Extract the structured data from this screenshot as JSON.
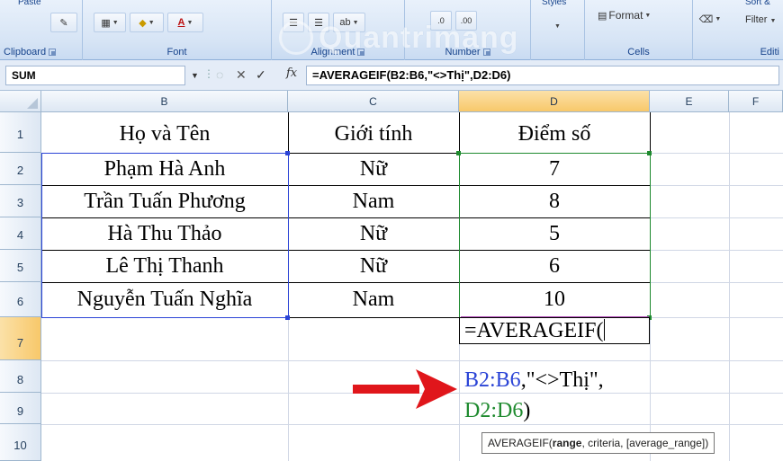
{
  "ribbon": {
    "groups": {
      "clipboard": {
        "label": "Clipboard",
        "cutoff": "Paste"
      },
      "font": {
        "label": "Font"
      },
      "alignment": {
        "label": "Alignment"
      },
      "number": {
        "label": "Number"
      },
      "styles": {
        "cutoff": "Styles"
      },
      "cells": {
        "label": "Cells",
        "format_label": "Format"
      },
      "editing": {
        "label": "Editi",
        "filter_label": "Filter",
        "sort_cutoff": "Sort &"
      }
    },
    "watermark": "Quantrimang"
  },
  "formula_bar": {
    "name_box": "SUM",
    "fx_label": "fx",
    "formula": "=AVERAGEIF(B2:B6,\"<>Thị\",D2:D6)"
  },
  "columns": [
    "B",
    "C",
    "D",
    "E",
    "F"
  ],
  "rows": [
    "1",
    "2",
    "3",
    "4",
    "5",
    "6",
    "7",
    "8",
    "9",
    "10"
  ],
  "active_column": "D",
  "active_row": "7",
  "table": {
    "headers": [
      "Họ và Tên",
      "Giới tính",
      "Điểm số"
    ],
    "data": [
      [
        "Phạm Hà Anh",
        "Nữ",
        "7"
      ],
      [
        "Trần Tuấn Phương",
        "Nam",
        "8"
      ],
      [
        "Hà Thu Thảo",
        "Nữ",
        "5"
      ],
      [
        "Lê Thị Thanh",
        "Nữ",
        "6"
      ],
      [
        "Nguyễn Tuấn Nghĩa",
        "Nam",
        "10"
      ]
    ]
  },
  "editing_cell": {
    "line1": "=AVERAGEIF(",
    "range_ref": "B2:B6",
    "criteria": ",\"<>Thị\",",
    "avg_ref": "D2:D6",
    "close": ")"
  },
  "tooltip": {
    "func": "AVERAGEIF(",
    "arg_bold": "range",
    "rest": ", criteria, [average_range])"
  },
  "colors": {
    "range_blue": "#2b44d6",
    "range_green": "#1e8a2e",
    "arrow_red": "#e0161b",
    "active_header": "#f8c86a"
  }
}
